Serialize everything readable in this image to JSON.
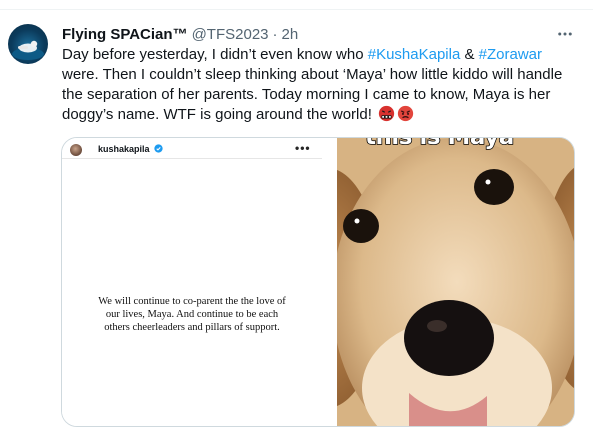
{
  "tweet": {
    "author_name": "Flying SPACian™",
    "handle": "@TFS2023",
    "separator": "·",
    "time": "2h",
    "text_before_tag1": "Day before yesterday, I didn’t even know who ",
    "hashtag1": "#KushaKapila",
    "text_between": " & ",
    "hashtag2": "#Zorawar",
    "text_after": " were. Then I couldn’t sleep thinking about ‘Maya’ how little kiddo will handle the separation of her parents. Today morning I came to know, Maya is her doggy’s name. WTF is going around the world! ",
    "emojis": [
      "angry-cursing-face-icon",
      "angry-face-icon"
    ]
  },
  "media": {
    "left_post": {
      "username": "kushakapila",
      "verified_icon": "verified-badge-icon",
      "more_label": "•••",
      "quote": "We will continue to co-parent the the love of our lives, Maya. And continue to be each others cheerleaders and pillars of support."
    },
    "right_image": {
      "caption": "this is Maya",
      "subject": "golden retriever puppy"
    }
  },
  "colors": {
    "hashtag": "#1d9bf0",
    "secondary_text": "#536471",
    "border": "#cfd9de"
  }
}
